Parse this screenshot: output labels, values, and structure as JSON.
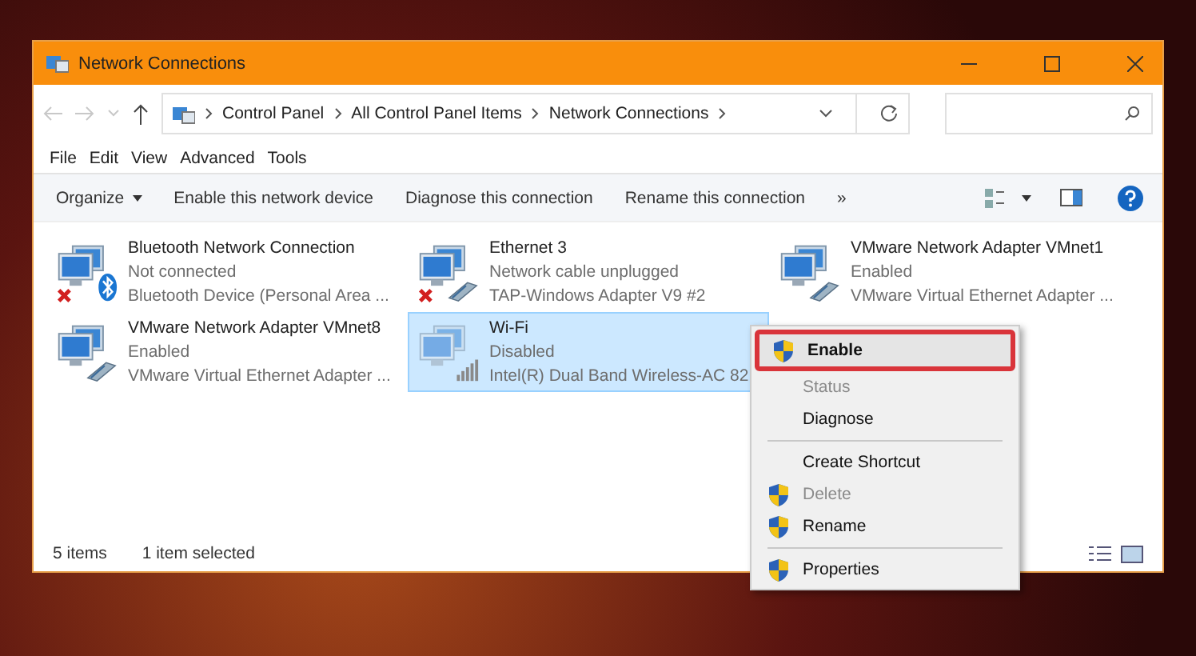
{
  "window": {
    "title": "Network Connections"
  },
  "address": {
    "crumbs": [
      "Control Panel",
      "All Control Panel Items",
      "Network Connections"
    ]
  },
  "menu": [
    "File",
    "Edit",
    "View",
    "Advanced",
    "Tools"
  ],
  "commands": [
    {
      "label": "Organize",
      "dropdown": true
    },
    {
      "label": "Enable this network device",
      "dropdown": false
    },
    {
      "label": "Diagnose this connection",
      "dropdown": false
    },
    {
      "label": "Rename this connection",
      "dropdown": false
    },
    {
      "label": "»",
      "dropdown": false
    }
  ],
  "connections": [
    {
      "name": "Bluetooth Network Connection",
      "status": "Not connected",
      "device": "Bluetooth Device (Personal Area ...",
      "kind": "bluetooth",
      "error": true,
      "selected": false
    },
    {
      "name": "Ethernet 3",
      "status": "Network cable unplugged",
      "device": "TAP-Windows Adapter V9 #2",
      "kind": "cable",
      "error": true,
      "selected": false
    },
    {
      "name": "VMware Network Adapter VMnet1",
      "status": "Enabled",
      "device": "VMware Virtual Ethernet Adapter ...",
      "kind": "cable",
      "error": false,
      "selected": false
    },
    {
      "name": "VMware Network Adapter VMnet8",
      "status": "Enabled",
      "device": "VMware Virtual Ethernet Adapter ...",
      "kind": "cable",
      "error": false,
      "selected": false
    },
    {
      "name": "Wi-Fi",
      "status": "Disabled",
      "device": "Intel(R) Dual Band Wireless-AC 82",
      "kind": "wifi",
      "error": false,
      "selected": true
    }
  ],
  "status_bar": {
    "count": "5 items",
    "selection": "1 item selected"
  },
  "context_menu": [
    {
      "kind": "item",
      "label": "Enable",
      "shield": true,
      "disabled": false,
      "highlighted": true
    },
    {
      "kind": "item",
      "label": "Status",
      "shield": false,
      "disabled": true,
      "highlighted": false
    },
    {
      "kind": "item",
      "label": "Diagnose",
      "shield": false,
      "disabled": false,
      "highlighted": false
    },
    {
      "kind": "separator"
    },
    {
      "kind": "item",
      "label": "Create Shortcut",
      "shield": false,
      "disabled": false,
      "highlighted": false
    },
    {
      "kind": "item",
      "label": "Delete",
      "shield": true,
      "disabled": true,
      "highlighted": false
    },
    {
      "kind": "item",
      "label": "Rename",
      "shield": true,
      "disabled": false,
      "highlighted": false
    },
    {
      "kind": "separator"
    },
    {
      "kind": "item",
      "label": "Properties",
      "shield": true,
      "disabled": false,
      "highlighted": false
    }
  ]
}
